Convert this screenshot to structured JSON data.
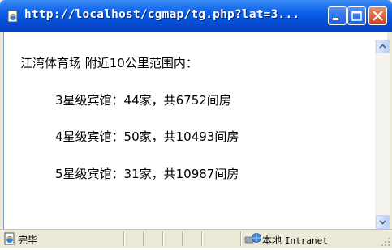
{
  "window": {
    "title": "http://localhost/cgmap/tg.php?lat=3..."
  },
  "content": {
    "heading": "江湾体育场 附近10公里范围内：",
    "lines": [
      "3星级宾馆：44家，共6752间房",
      "4星级宾馆：50家，共10493间房",
      "5星级宾馆：31家，共10987间房"
    ]
  },
  "statusbar": {
    "status": "完毕",
    "zone_cn": "本地",
    "zone_en": "Intranet"
  },
  "icons": {
    "title": "ie-page-icon",
    "status": "ie-page-icon",
    "zone": "intranet-globe-icon"
  },
  "colors": {
    "titlebar": "#0a5ee8",
    "close_button": "#c6461b",
    "chrome": "#ece9d8"
  }
}
